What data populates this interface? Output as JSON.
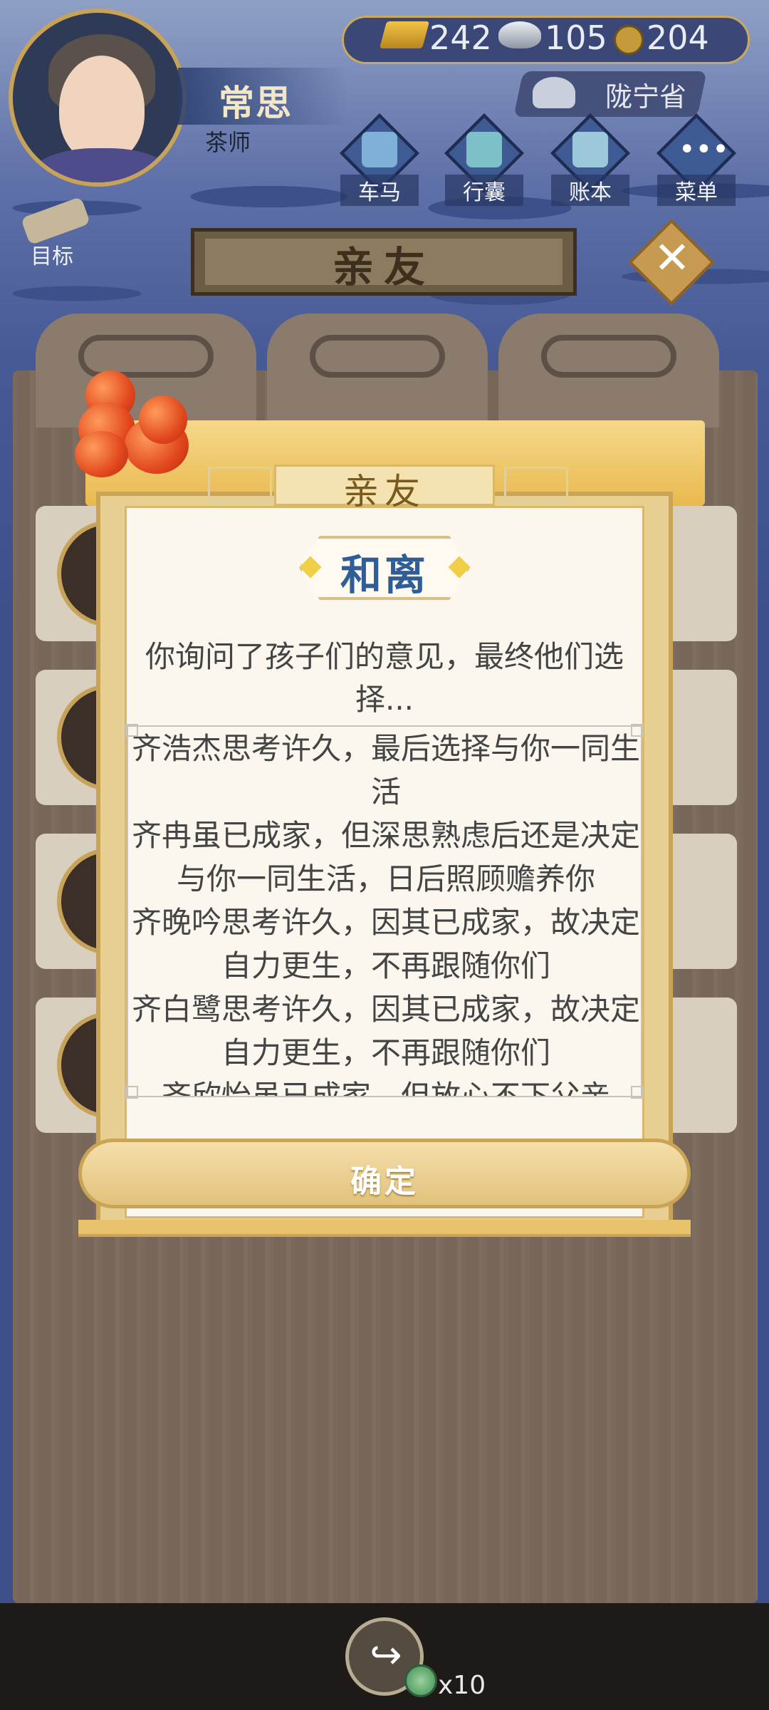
{
  "player": {
    "name": "常思",
    "title": "茶师"
  },
  "currency": {
    "gold": "242",
    "silver": "105",
    "coins": "204"
  },
  "region": "陇宁省",
  "nav": [
    {
      "label": "车马",
      "icon": "carriage-icon"
    },
    {
      "label": "行囊",
      "icon": "bag-icon"
    },
    {
      "label": "账本",
      "icon": "ledger-icon"
    },
    {
      "label": "菜单",
      "icon": "menu-icon"
    }
  ],
  "goal_label": "目标",
  "screen_title": "亲友",
  "dialog": {
    "header": "亲友",
    "subtitle": "和离",
    "intro": "你询问了孩子们的意见，最终他们选择...",
    "results": [
      "齐浩杰思考许久，最后选择与你一同生活",
      "齐冉虽已成家，但深思熟虑后还是决定与你一同生活，日后照顾赡养你",
      "齐晚吟思考许久，因其已成家，故决定自力更生，不再跟随你们",
      "齐白鹭思考许久，因其已成家，故决定自力更生，不再跟随你们",
      "齐欣怡虽已成家，但放心不下父亲"
    ],
    "confirm": "确定"
  },
  "share": {
    "count": "x10"
  },
  "colors": {
    "accent_gold": "#c9a455",
    "subtitle_blue": "#2f5d97",
    "sky_blue": "#3d4f8a"
  }
}
